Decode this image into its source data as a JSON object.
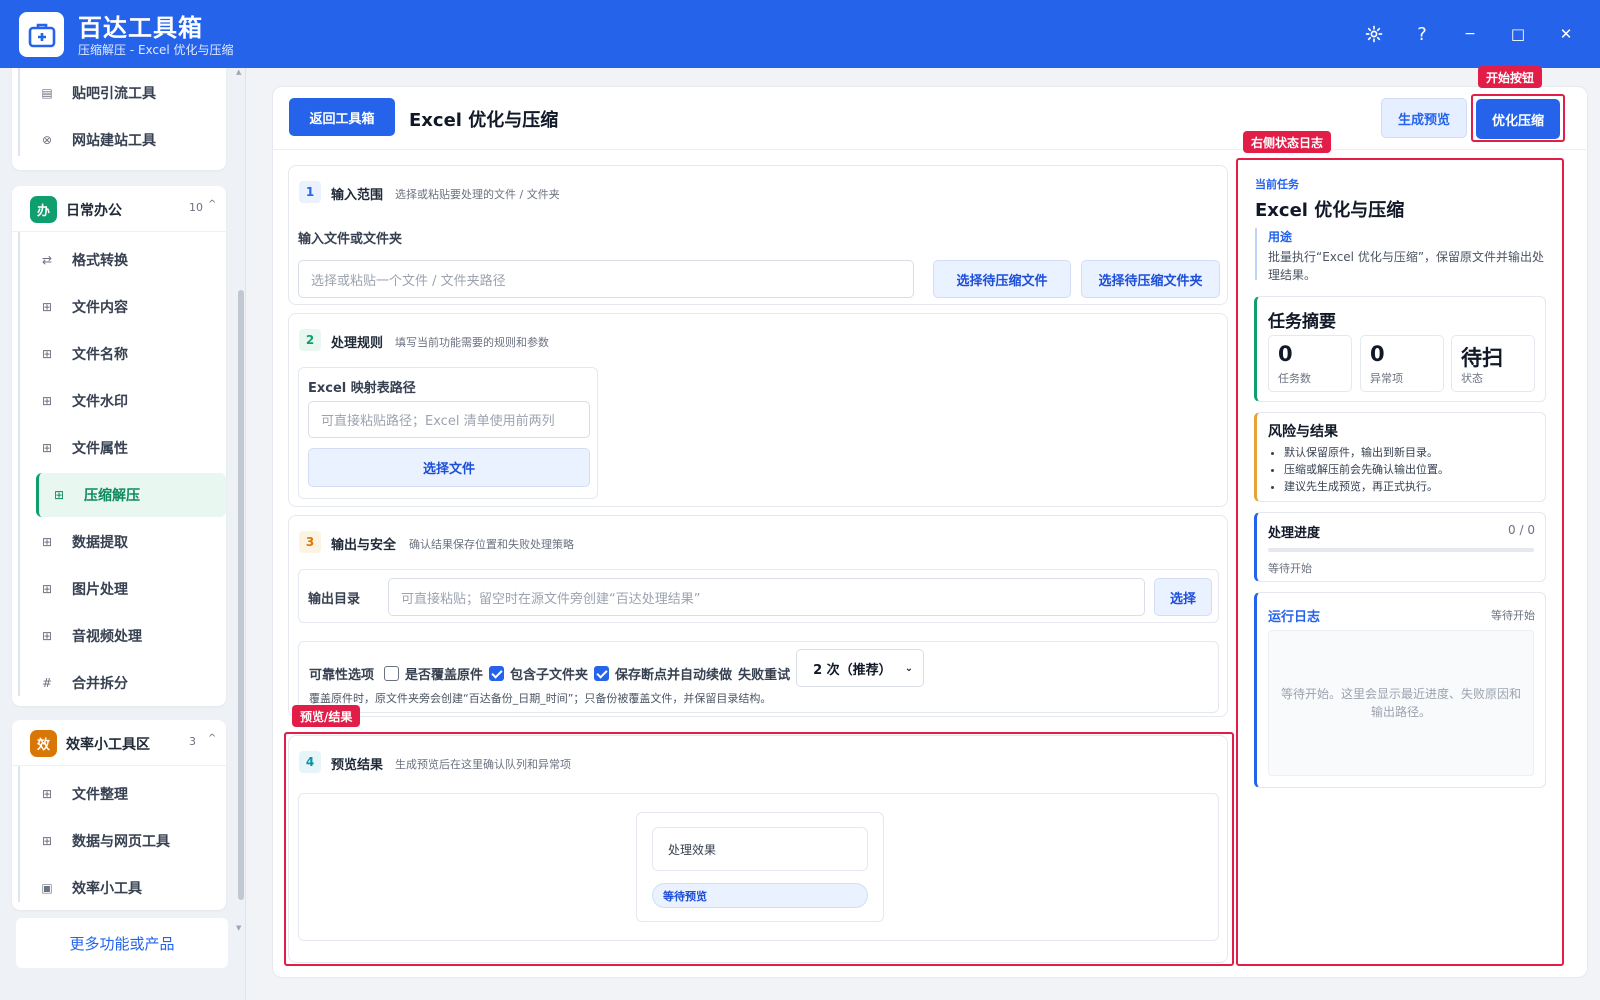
{
  "titlebar": {
    "app_name": "百达工具箱",
    "subtitle": "压缩解压 - Excel 优化与压缩",
    "settings_icon": "gear-icon",
    "help_label": "?",
    "minimize_label": "−",
    "maximize_label": "□",
    "close_label": "✕"
  },
  "sidebar": {
    "top_items": [
      {
        "label": "贴吧引流工具",
        "icon": "document-icon"
      },
      {
        "label": "网站建站工具",
        "icon": "globe-icon"
      }
    ],
    "group_daily": {
      "badge": "办",
      "title": "日常办公",
      "count": "10",
      "chevron": "^",
      "items": [
        {
          "label": "格式转换",
          "icon": "swap-icon"
        },
        {
          "label": "文件内容",
          "icon": "grid-icon"
        },
        {
          "label": "文件名称",
          "icon": "grid-icon"
        },
        {
          "label": "文件水印",
          "icon": "grid-icon"
        },
        {
          "label": "文件属性",
          "icon": "grid-icon"
        },
        {
          "label": "压缩解压",
          "icon": "grid-icon"
        },
        {
          "label": "数据提取",
          "icon": "grid-icon"
        },
        {
          "label": "图片处理",
          "icon": "grid-icon"
        },
        {
          "label": "音视频处理",
          "icon": "grid-icon"
        },
        {
          "label": "合并拆分",
          "icon": "hash-icon"
        }
      ]
    },
    "group_efficiency": {
      "badge": "效",
      "title": "效率小工具区",
      "count": "3",
      "chevron": "^",
      "items": [
        {
          "label": "文件整理",
          "icon": "grid-icon"
        },
        {
          "label": "数据与网页工具",
          "icon": "grid-icon"
        },
        {
          "label": "效率小工具",
          "icon": "box-icon"
        }
      ]
    },
    "more_label": "更多功能或产品"
  },
  "header": {
    "back_label": "返回工具箱",
    "title": "Excel 优化与压缩",
    "preview_label": "生成预览",
    "start_label": "优化压缩"
  },
  "section1": {
    "num": "1",
    "title": "输入范围",
    "desc": "选择或粘贴要处理的文件 / 文件夹",
    "field_label": "输入文件或文件夹",
    "placeholder": "选择或粘贴一个文件 / 文件夹路径",
    "btn_file": "选择待压缩文件",
    "btn_folder": "选择待压缩文件夹"
  },
  "section2": {
    "num": "2",
    "title": "处理规则",
    "desc": "填写当前功能需要的规则和参数",
    "field_label": "Excel 映射表路径",
    "placeholder": "可直接粘贴路径；Excel 清单使用前两列",
    "btn_select": "选择文件"
  },
  "section3": {
    "num": "3",
    "title": "输出与安全",
    "desc": "确认结果保存位置和失败处理策略",
    "output_label": "输出目录",
    "output_placeholder": "可直接粘贴；留空时在源文件旁创建“百达处理结果”",
    "btn_select": "选择",
    "reliability_label": "可靠性选项",
    "opt_overwrite": "是否覆盖原件",
    "opt_subfolders": "包含子文件夹",
    "opt_resume": "保存断点并自动续做",
    "retry_label": "失败重试",
    "retry_value": "2 次（推荐）",
    "note": "覆盖原件时，原文件夹旁会创建“百达备份_日期_时间”；只备份被覆盖文件，并保留目录结构。"
  },
  "section4": {
    "num": "4",
    "title": "预览结果",
    "desc": "生成预览后在这里确认队列和异常项",
    "effect_label": "处理效果",
    "status_pill": "等待预览"
  },
  "right_panel": {
    "current_task_label": "当前任务",
    "task_title": "Excel 优化与压缩",
    "purpose_label": "用途",
    "purpose_text": "批量执行“Excel 优化与压缩”，保留原文件并输出处理结果。",
    "summary_title": "任务摘要",
    "summary": [
      {
        "value": "0",
        "label": "任务数"
      },
      {
        "value": "0",
        "label": "异常项"
      },
      {
        "value": "待扫",
        "label": "状态"
      }
    ],
    "risk_title": "风险与结果",
    "risks": [
      "默认保留原件，输出到新目录。",
      "压缩或解压前会先确认输出位置。",
      "建议先生成预览，再正式执行。"
    ],
    "progress_title": "处理进度",
    "progress_count": "0 / 0",
    "progress_value": 0,
    "progress_status": "等待开始",
    "log_title": "运行日志",
    "log_status": "等待开始",
    "log_placeholder": "等待开始。这里会显示最近进度、失败原因和输出路径。"
  },
  "annotations": {
    "start_button": "开始按钮",
    "right_log": "右侧状态日志",
    "preview_result": "预览/结果"
  },
  "colors": {
    "brand": "#2563eb",
    "active_green": "#0f9f6e",
    "annotation_red": "#e11d48"
  }
}
